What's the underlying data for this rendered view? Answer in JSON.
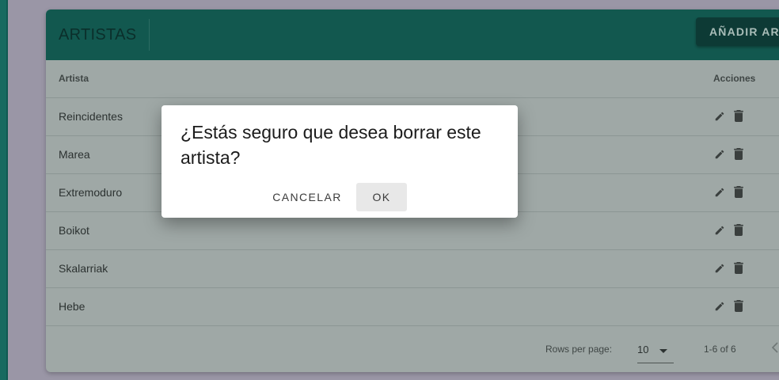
{
  "page": {
    "title": "ARTISTAS",
    "add_button_label": "AÑADIR ART"
  },
  "table": {
    "headers": {
      "artist": "Artista",
      "actions": "Acciones"
    },
    "rows": [
      {
        "name": "Reincidentes"
      },
      {
        "name": "Marea"
      },
      {
        "name": "Extremoduro"
      },
      {
        "name": "Boikot"
      },
      {
        "name": "Skalarriak"
      },
      {
        "name": "Hebe"
      }
    ],
    "actions": [
      "edit-icon",
      "delete-icon"
    ]
  },
  "pagination": {
    "rows_per_page_label": "Rows per page:",
    "rows_per_page_value": "10",
    "range_text": "1-6 of 6"
  },
  "dialog": {
    "title": "¿Estás seguro que desea borrar este artista?",
    "cancel_label": "CANCELAR",
    "ok_label": "OK"
  },
  "colors": {
    "header_bg": "#12584f",
    "left_rail": "#176a60",
    "overlay_bg": "#9a96a6"
  }
}
